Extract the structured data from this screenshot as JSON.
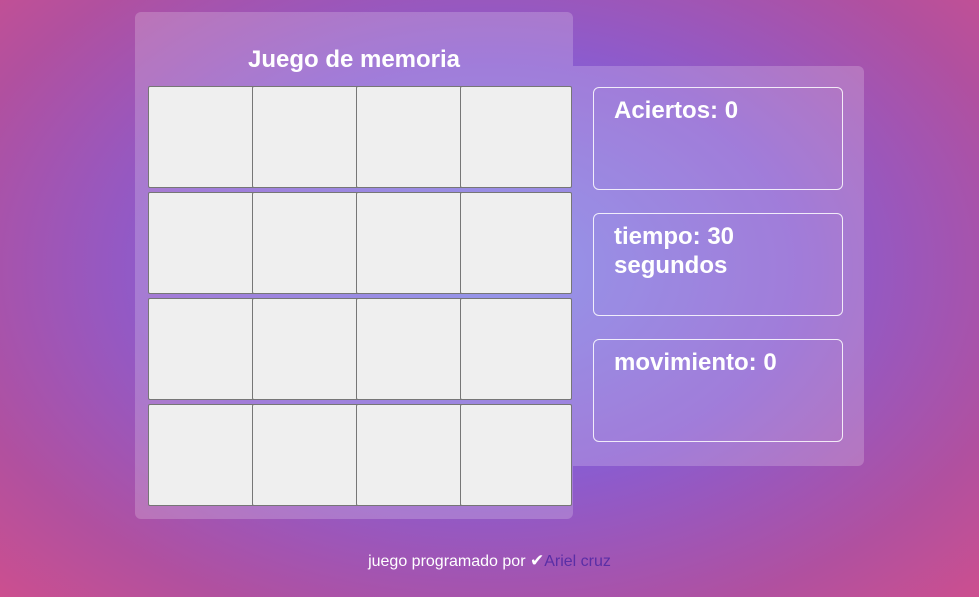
{
  "game": {
    "title": "Juego de memoria",
    "card_count": 16
  },
  "stats": {
    "hits_label": "Aciertos: 0",
    "time_label": "tiempo: 30 segundos",
    "moves_label": "movimiento: 0"
  },
  "footer": {
    "text": "juego programado por",
    "check_icon": "✔",
    "author": "Ariel cruz"
  }
}
